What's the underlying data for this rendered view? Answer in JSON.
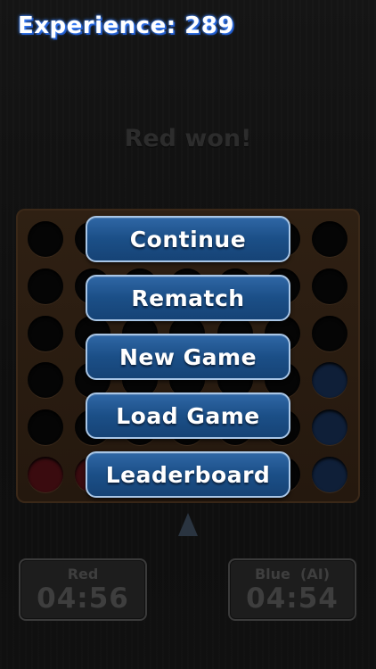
{
  "header": {
    "experience": "Experience: 289"
  },
  "status": {
    "message": "Red won!"
  },
  "menu": {
    "items": [
      {
        "label": "Continue"
      },
      {
        "label": "Rematch"
      },
      {
        "label": "New Game"
      },
      {
        "label": "Load Game"
      },
      {
        "label": "Leaderboard"
      }
    ]
  },
  "players": {
    "red": {
      "name": "Red",
      "time": "04:56"
    },
    "blue": {
      "name": "Blue  (AI)",
      "time": "04:54"
    }
  },
  "colors": {
    "menu_button": "#1b4f87",
    "menu_border": "#a9c6e6",
    "experience_glow": "#3f86ff",
    "board": "#2f2013"
  }
}
